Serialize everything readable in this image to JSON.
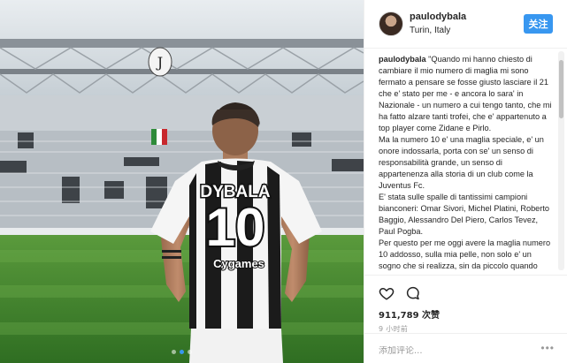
{
  "photo": {
    "jersey_name": "DYBALA",
    "jersey_number": "10",
    "sponsor": "Cygames",
    "carousel_count": 3,
    "carousel_active": 1
  },
  "post": {
    "username": "paulodybala",
    "location": "Turin, Italy",
    "follow_label": "关注",
    "caption_user": "paulodybala",
    "caption_text": " \"Quando mi hanno chiesto di cambiare il mio numero di maglia mi sono fermato a pensare se fosse giusto lasciare il 21 che e' stato per me - e ancora lo sara' in Nazionale - un numero a cui tengo tanto, che mi ha fatto alzare tanti trofei, che e' appartenuto a top player come Zidane e Pirlo.\nMa la numero 10 e' una maglia speciale, e' un onore indossarla, porta con se' un senso di responsabilità grande, un senso di appartenenza alla storia di un club come la Juventus Fc.\nE' stata sulle spalle di tantissimi campioni bianconeri: Omar Sivori, Michel Platini, Roberto Baggio, Alessandro Del Piero, Carlos Tevez, Paul Pogba.\nPer questo per me oggi avere la maglia numero 10 addosso, sulla mia pelle, non solo e' un sogno che si realizza, sin da piccolo quando giocavo a calcio.",
    "likes": "911,789 次赞",
    "time": "9 小时前",
    "comment_placeholder": "添加评论...",
    "more_label": "•••"
  },
  "icons": {
    "like": "heart-icon",
    "comment": "comment-bubble-icon",
    "more": "more-options-icon"
  },
  "colors": {
    "accent": "#3897f0",
    "meta_gray": "#999999"
  }
}
